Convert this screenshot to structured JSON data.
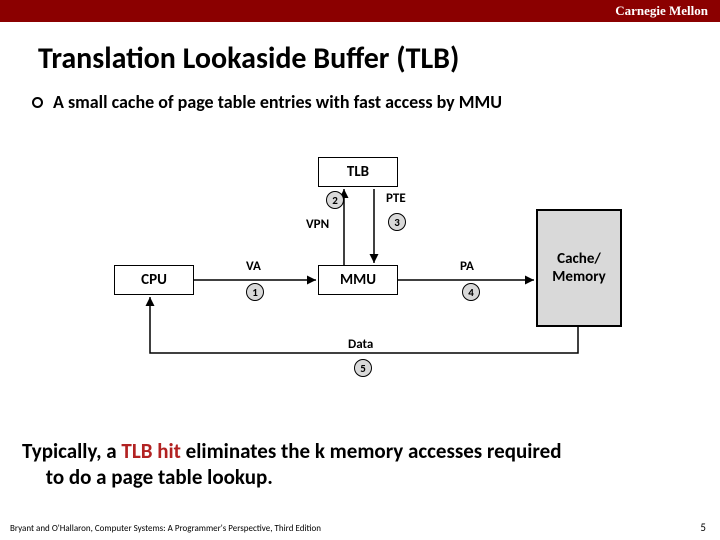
{
  "header": {
    "brand": "Carnegie Mellon"
  },
  "title": "Translation Lookaside Buffer (TLB)",
  "bullet": "A small cache of page table entries with fast access by MMU",
  "diagram": {
    "nodes": {
      "tlb": "TLB",
      "cpu": "CPU",
      "mmu": "MMU",
      "cache_line1": "Cache/",
      "cache_line2": "Memory"
    },
    "labels": {
      "va": "VA",
      "vpn": "VPN",
      "pte": "PTE",
      "pa": "PA",
      "data": "Data"
    },
    "steps": {
      "1": "1",
      "2": "2",
      "3": "3",
      "4": "4",
      "5": "5"
    }
  },
  "footnote": {
    "prefix": "Typically, a ",
    "hit": "TLB hit",
    "suffix1": " eliminates the k memory accesses required",
    "suffix2": "to do a page table lookup."
  },
  "footer": "Bryant and O'Hallaron, Computer Systems: A Programmer's Perspective, Third Edition",
  "page": "5"
}
